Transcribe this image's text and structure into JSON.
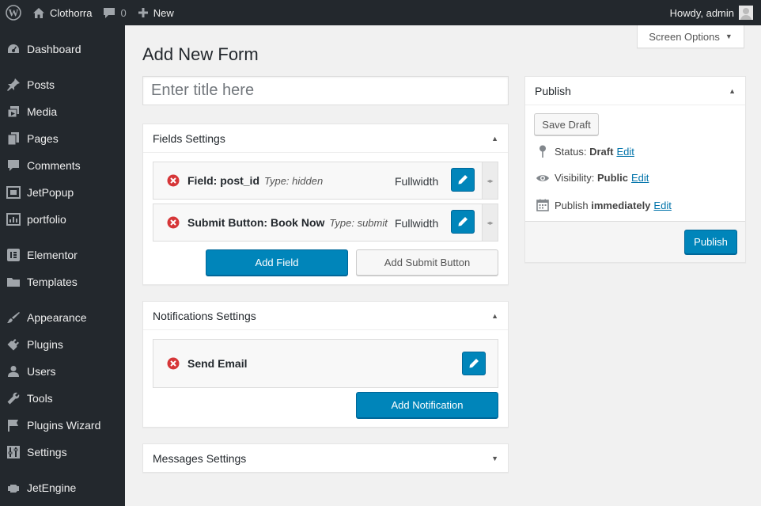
{
  "adminbar": {
    "site_name": "Clothorra",
    "comments_count": "0",
    "new_label": "New",
    "howdy": "Howdy, admin"
  },
  "sidebar": {
    "items": [
      {
        "label": "Dashboard",
        "icon": "dashboard-icon"
      },
      {
        "label": "Posts",
        "icon": "pin-icon"
      },
      {
        "label": "Media",
        "icon": "media-icon"
      },
      {
        "label": "Pages",
        "icon": "pages-icon"
      },
      {
        "label": "Comments",
        "icon": "comment-icon"
      },
      {
        "label": "JetPopup",
        "icon": "jetpopup-icon"
      },
      {
        "label": "portfolio",
        "icon": "portfolio-icon"
      },
      {
        "label": "Elementor",
        "icon": "elementor-icon"
      },
      {
        "label": "Templates",
        "icon": "folder-icon"
      },
      {
        "label": "Appearance",
        "icon": "brush-icon"
      },
      {
        "label": "Plugins",
        "icon": "plugin-icon"
      },
      {
        "label": "Users",
        "icon": "user-icon"
      },
      {
        "label": "Tools",
        "icon": "wrench-icon"
      },
      {
        "label": "Plugins Wizard",
        "icon": "flag-icon"
      },
      {
        "label": "Settings",
        "icon": "settings-icon"
      },
      {
        "label": "JetEngine",
        "icon": "engine-icon"
      }
    ]
  },
  "main": {
    "page_title": "Add New Form",
    "screen_options": "Screen Options",
    "title_placeholder": "Enter title here"
  },
  "fields_settings": {
    "title": "Fields Settings",
    "fields": [
      {
        "name": "Field: post_id",
        "type": "Type: hidden",
        "width": "Fullwidth"
      },
      {
        "name": "Submit Button: Book Now",
        "type": "Type: submit",
        "width": "Fullwidth"
      }
    ],
    "add_field": "Add Field",
    "add_submit": "Add Submit Button"
  },
  "notifications_settings": {
    "title": "Notifications Settings",
    "items": [
      {
        "name": "Send Email"
      }
    ],
    "add_notification": "Add Notification"
  },
  "messages_settings": {
    "title": "Messages Settings"
  },
  "publish": {
    "title": "Publish",
    "save_draft": "Save Draft",
    "status_label": "Status:",
    "status_value": "Draft",
    "visibility_label": "Visibility:",
    "visibility_value": "Public",
    "publish_label": "Publish",
    "publish_value": "immediately",
    "edit": "Edit",
    "publish_button": "Publish"
  },
  "colors": {
    "primary": "#0085ba",
    "adminbar": "#23282d",
    "link": "#0073aa",
    "delete": "#d63638"
  }
}
